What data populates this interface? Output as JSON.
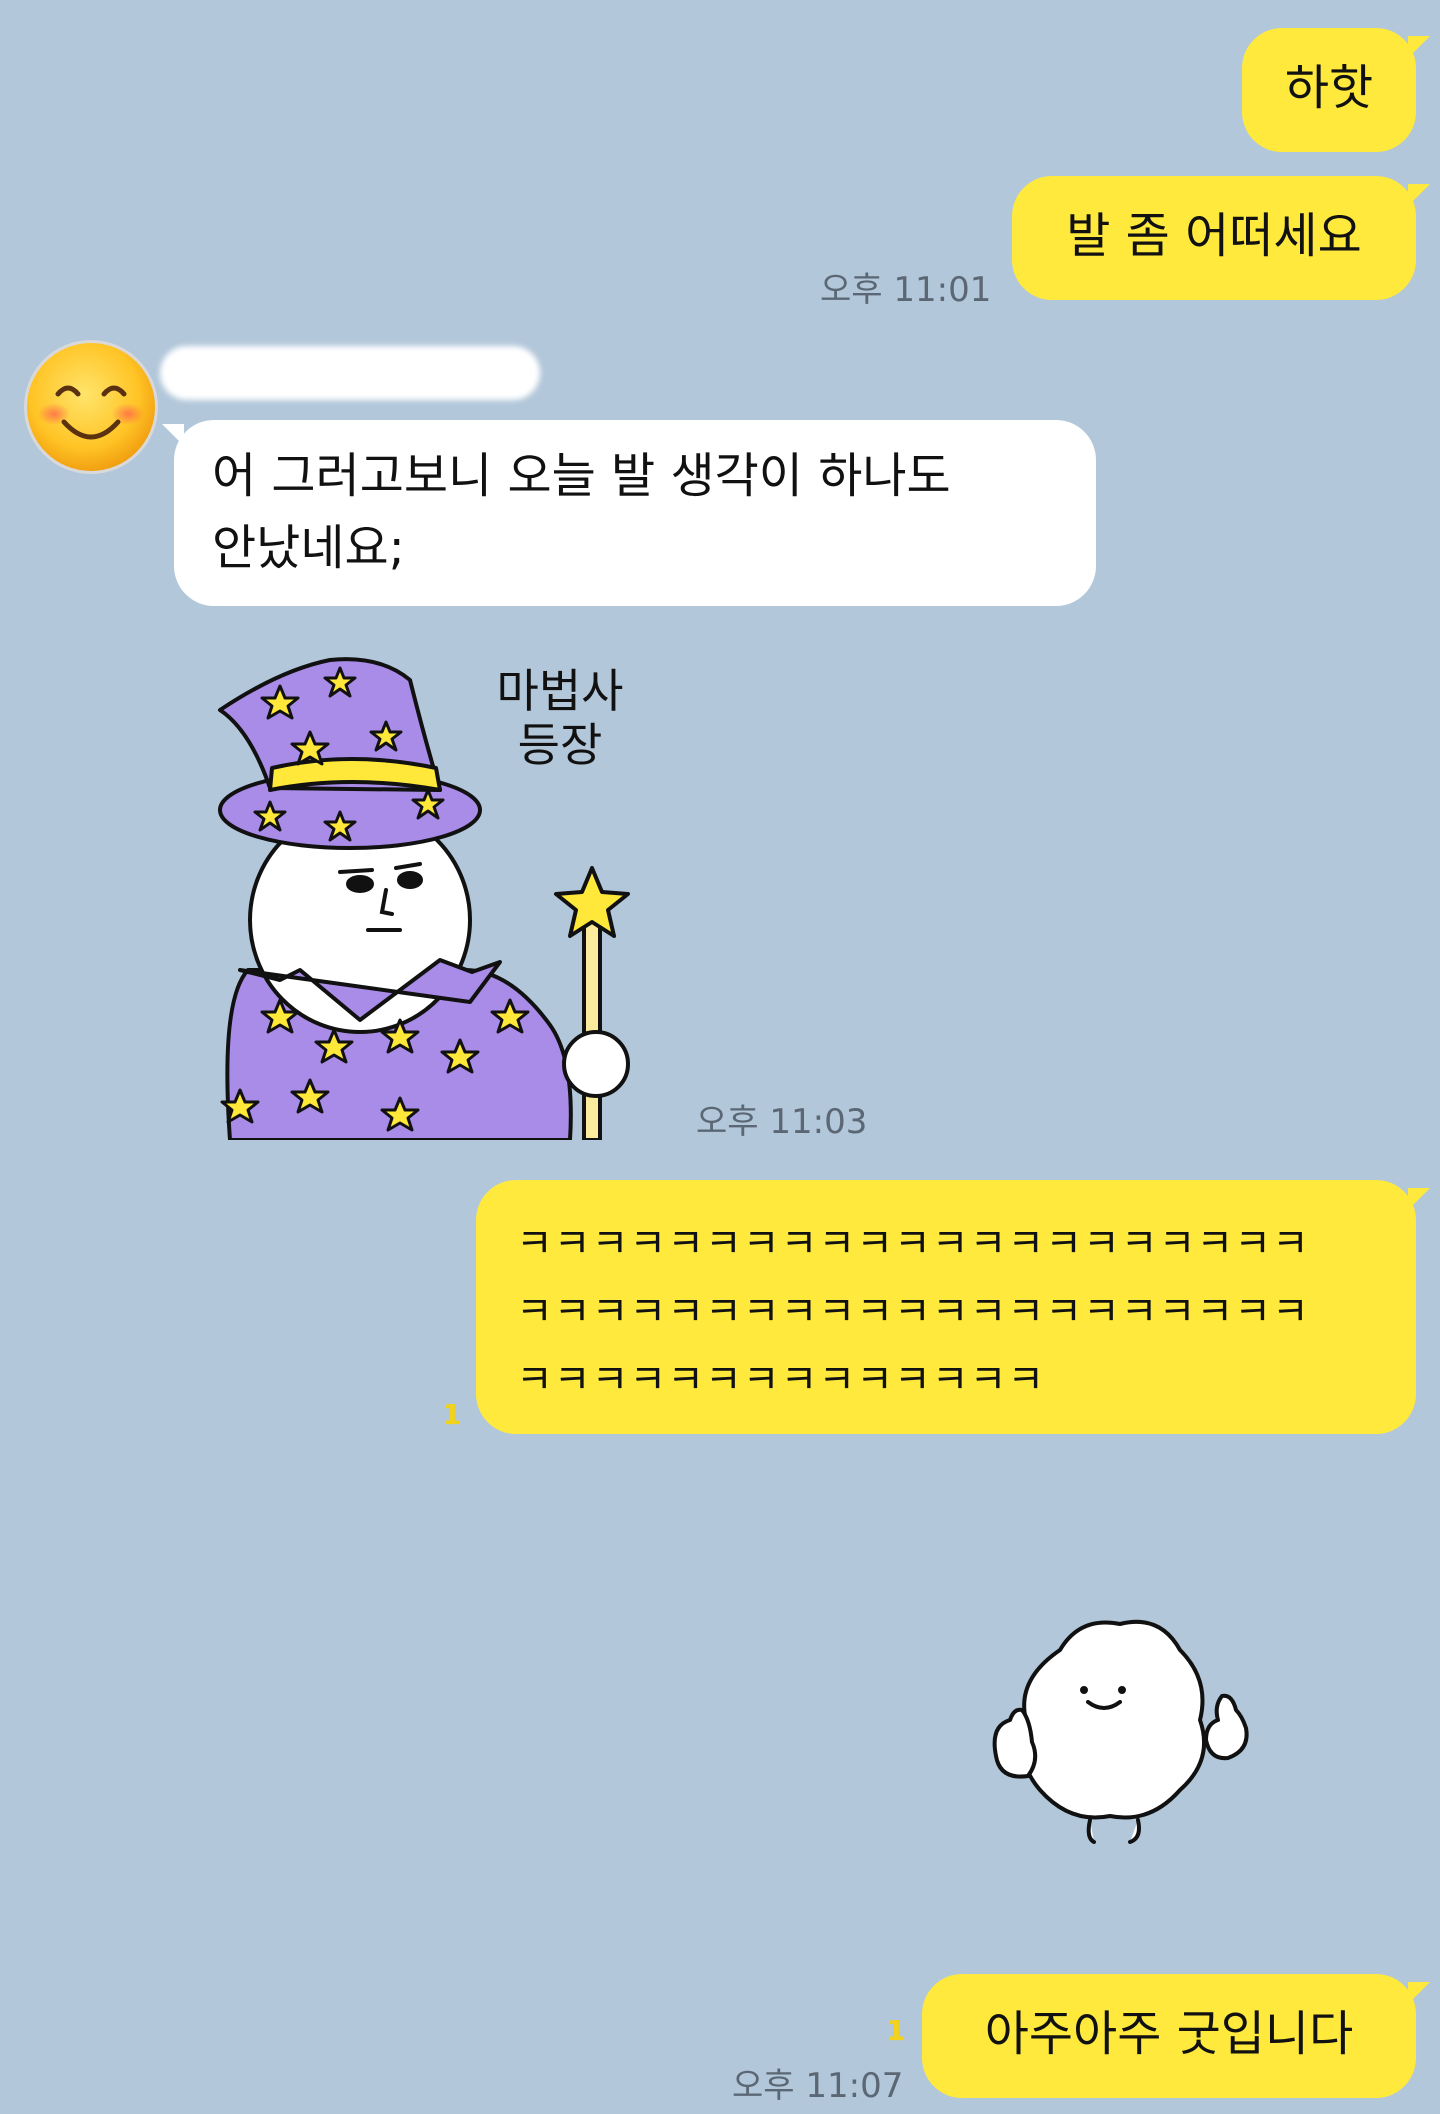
{
  "messages": {
    "m1": {
      "text": "하핫"
    },
    "m2": {
      "text": "발 좀 어떠세요",
      "time": "오후 11:01"
    },
    "m3": {
      "line1": "어 그러고보니 오늘 발 생각이 하나도",
      "line2": "안났네요;"
    },
    "m4": {
      "caption_line1": "마법사",
      "caption_line2": "등장",
      "time": "오후 11:03"
    },
    "m5": {
      "line1": "ㅋㅋㅋㅋㅋㅋㅋㅋㅋㅋㅋㅋㅋㅋㅋㅋㅋㅋㅋㅋㅋ",
      "line2": "ㅋㅋㅋㅋㅋㅋㅋㅋㅋㅋㅋㅋㅋㅋㅋㅋㅋㅋㅋㅋㅋ",
      "line3": "ㅋㅋㅋㅋㅋㅋㅋㅋㅋㅋㅋㅋㅋㅋ",
      "unread": "1"
    },
    "m6": {
      "sticker": "thumbs-up-blob-sticker"
    },
    "m7": {
      "text": "아주아주 굿입니다",
      "unread": "1",
      "time": "오후 11:07"
    }
  },
  "colors": {
    "background": "#b2c7da",
    "my_bubble": "#fee93c",
    "their_bubble": "#ffffff",
    "wizard_robe": "#a98be8",
    "star": "#ffec3d"
  }
}
